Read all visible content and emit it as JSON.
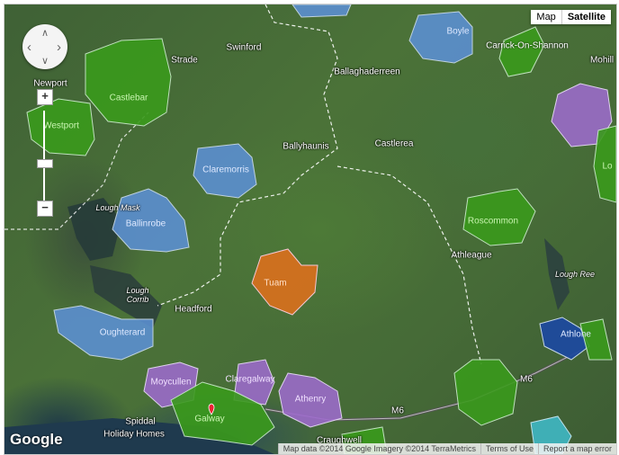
{
  "map_type": {
    "map_label": "Map",
    "satellite_label": "Satellite"
  },
  "pan": {
    "up": "∧",
    "down": "∨",
    "left": "‹",
    "right": "›"
  },
  "zoom": {
    "in": "+",
    "out": "−",
    "level_fraction": 0.45
  },
  "places": {
    "newport": "Newport",
    "swinford": "Swinford",
    "strade": "Strade",
    "ballaghaderreen": "Ballaghaderreen",
    "mohill": "Mohill",
    "ballyhaunis": "Ballyhaunis",
    "castlerea": "Castlerea",
    "lough_mask": "Lough Mask",
    "lough_corrib": "Lough\nCorrib",
    "headford": "Headford",
    "athleague": "Athleague",
    "lough_ree": "Lough Ree",
    "spiddal": "Spiddal",
    "holiday_homes": "Holiday Homes",
    "craughwell": "Craughwell",
    "m6": "M6",
    "m6b": "M6"
  },
  "regions": {
    "boyle": "Boyle",
    "carrick": "Carrick-On-Shannon",
    "castlebar": "Castlebar",
    "westport": "Westport",
    "claremorris": "Claremorris",
    "ballinrobe": "Ballinrobe",
    "roscommon": "Roscommon",
    "tuam": "Tuam",
    "oughterard": "Oughterard",
    "athlone": "Athlone",
    "moycullen": "Moycullen",
    "claregalway": "Claregalway",
    "athenry": "Athenry",
    "galway": "Galway",
    "lo": "Lo"
  },
  "colors": {
    "green": "#3a9a1c",
    "blue": "#5b8fd0",
    "purple": "#9b6bc9",
    "orange": "#d4701e",
    "darkblue": "#1e4a9e",
    "cyan": "#3fb8c4"
  },
  "attribution": {
    "logo": "Google",
    "data": "Map data ©2014 Google Imagery ©2014 TerraMetrics",
    "terms": "Terms of Use",
    "report": "Report a map error"
  }
}
